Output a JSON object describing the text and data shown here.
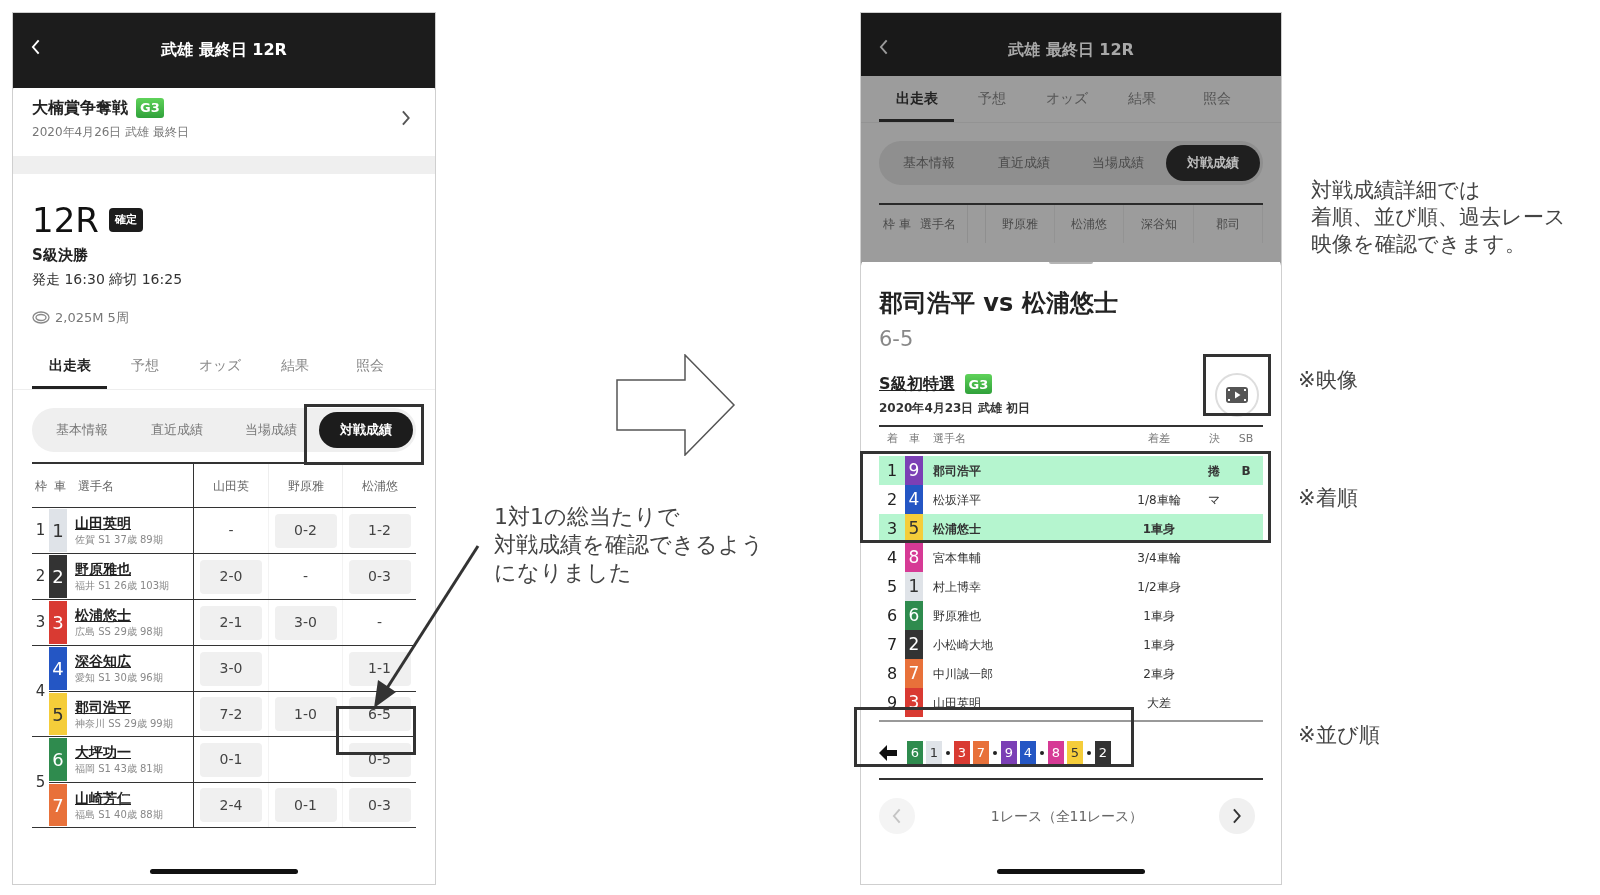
{
  "left_screen": {
    "header": {
      "title": "武雄 最終日 12R"
    },
    "event": {
      "name": "大楠賞争奪戦",
      "grade": "G3",
      "date": "2020年4月26日 武雄 最終日"
    },
    "race": {
      "number": "12R",
      "status": "確定",
      "class": "S級決勝",
      "times": "発走 16:30 締切 16:25",
      "distance": "2,025M 5周"
    },
    "tabs": [
      {
        "label": "出走表",
        "selected": true
      },
      {
        "label": "予想",
        "selected": false
      },
      {
        "label": "オッズ",
        "selected": false
      },
      {
        "label": "結果",
        "selected": false
      },
      {
        "label": "照会",
        "selected": false
      }
    ],
    "subtabs": [
      {
        "label": "基本情報",
        "selected": false
      },
      {
        "label": "直近成績",
        "selected": false
      },
      {
        "label": "当場成績",
        "selected": false
      },
      {
        "label": "対戦成績",
        "selected": true
      }
    ],
    "table": {
      "columns": [
        "枠",
        "車",
        "選手名",
        "山田英",
        "野原雅",
        "松浦悠"
      ],
      "frames": [
        {
          "label": "1",
          "riders": [
            {
              "car": "1",
              "color": "#dfe3e8",
              "name": "山田英明",
              "info": "佐賀 S1 37歳 89期",
              "results": [
                {
                  "kind": "self",
                  "value": "-"
                },
                {
                  "kind": "score",
                  "value": "0-2"
                },
                {
                  "kind": "score",
                  "value": "1-2"
                }
              ]
            }
          ]
        },
        {
          "label": "2",
          "riders": [
            {
              "car": "2",
              "color": "#333333",
              "name": "野原雅也",
              "info": "福井 S1 26歳 103期",
              "results": [
                {
                  "kind": "score",
                  "value": "2-0"
                },
                {
                  "kind": "self",
                  "value": "-"
                },
                {
                  "kind": "score",
                  "value": "0-3"
                }
              ]
            }
          ]
        },
        {
          "label": "3",
          "riders": [
            {
              "car": "3",
              "color": "#d93a32",
              "name": "松浦悠士",
              "info": "広島 SS 29歳 98期",
              "results": [
                {
                  "kind": "score",
                  "value": "2-1"
                },
                {
                  "kind": "score",
                  "value": "3-0"
                },
                {
                  "kind": "self",
                  "value": "-"
                }
              ]
            }
          ]
        },
        {
          "label": "4",
          "riders": [
            {
              "car": "4",
              "color": "#2456c4",
              "name": "深谷知広",
              "info": "愛知 S1 30歳 96期",
              "results": [
                {
                  "kind": "score",
                  "value": "3-0"
                },
                {
                  "kind": "blank"
                },
                {
                  "kind": "score",
                  "value": "1-1"
                }
              ]
            },
            {
              "car": "5",
              "color": "#f5cd3a",
              "name": "郡司浩平",
              "info": "神奈川 SS 29歳 99期",
              "results": [
                {
                  "kind": "score",
                  "value": "7-2"
                },
                {
                  "kind": "score",
                  "value": "1-0"
                },
                {
                  "kind": "score",
                  "value": "6-5"
                }
              ]
            }
          ]
        },
        {
          "label": "5",
          "riders": [
            {
              "car": "6",
              "color": "#2f8b4e",
              "name": "大坪功一",
              "info": "福岡 S1 43歳 81期",
              "results": [
                {
                  "kind": "score",
                  "value": "0-1"
                },
                {
                  "kind": "blank"
                },
                {
                  "kind": "score",
                  "value": "0-5"
                }
              ]
            },
            {
              "car": "7",
              "color": "#e8713a",
              "name": "山崎芳仁",
              "info": "福島 S1 40歳 88期",
              "results": [
                {
                  "kind": "score",
                  "value": "2-4"
                },
                {
                  "kind": "score",
                  "value": "0-1"
                },
                {
                  "kind": "score",
                  "value": "0-3"
                }
              ]
            }
          ]
        }
      ]
    }
  },
  "right_screen": {
    "header": {
      "title": "武雄 最終日 12R"
    },
    "tabs": [
      {
        "label": "出走表",
        "selected": true
      },
      {
        "label": "予想",
        "selected": false
      },
      {
        "label": "オッズ",
        "selected": false
      },
      {
        "label": "結果",
        "selected": false
      },
      {
        "label": "照会",
        "selected": false
      }
    ],
    "subtabs": [
      {
        "label": "基本情報",
        "selected": false
      },
      {
        "label": "直近成績",
        "selected": false
      },
      {
        "label": "当場成績",
        "selected": false
      },
      {
        "label": "対戦成績",
        "selected": true
      }
    ],
    "table_columns": [
      "枠 車",
      "選手名",
      "野原雅",
      "松浦悠",
      "深谷知",
      "郡司"
    ],
    "sheet": {
      "title": "郡司浩平 vs 松浦悠士",
      "score": "6-5",
      "race_name": "S級初特選",
      "grade": "G3",
      "date": "2020年4月23日 武雄 初日",
      "columns": [
        "着",
        "車",
        "選手名",
        "着差",
        "決",
        "SB"
      ],
      "rows": [
        {
          "place": "1",
          "car": "9",
          "color": "#7b3fb5",
          "name": "郡司浩平",
          "kimarite": "捲",
          "sb": "B",
          "highlighted": true
        },
        {
          "place": "2",
          "car": "4",
          "color": "#2456c4",
          "name": "松坂洋平",
          "margin": "1/8車輪",
          "kimarite": "マ",
          "highlighted": false
        },
        {
          "place": "3",
          "car": "5",
          "color": "#f5cd3a",
          "name": "松浦悠士",
          "margin": "1車身",
          "highlighted": true
        },
        {
          "place": "4",
          "car": "8",
          "color": "#d63a95",
          "name": "宮本隼輔",
          "margin": "3/4車輪",
          "highlighted": false
        },
        {
          "place": "5",
          "car": "1",
          "color": "#dfe3e8",
          "name": "村上博幸",
          "margin": "1/2車身",
          "highlighted": false
        },
        {
          "place": "6",
          "car": "6",
          "color": "#2f8b4e",
          "name": "野原雅也",
          "margin": "1車身",
          "highlighted": false
        },
        {
          "place": "7",
          "car": "2",
          "color": "#333333",
          "name": "小松崎大地",
          "margin": "1車身",
          "highlighted": false
        },
        {
          "place": "8",
          "car": "7",
          "color": "#e8713a",
          "name": "中川誠一郎",
          "margin": "2車身",
          "highlighted": false
        },
        {
          "place": "9",
          "car": "3",
          "color": "#d93a32",
          "name": "山田英明",
          "margin": "大差",
          "highlighted": false
        }
      ],
      "lineup": [
        {
          "kind": "car",
          "label": "6",
          "color": "#2f8b4e"
        },
        {
          "kind": "car",
          "label": "1",
          "color": "#dfe3e8"
        },
        {
          "kind": "dot"
        },
        {
          "kind": "car",
          "label": "3",
          "color": "#d93a32"
        },
        {
          "kind": "car",
          "label": "7",
          "color": "#e8713a"
        },
        {
          "kind": "dot"
        },
        {
          "kind": "car",
          "label": "9",
          "color": "#7b3fb5"
        },
        {
          "kind": "car",
          "label": "4",
          "color": "#2456c4"
        },
        {
          "kind": "dot"
        },
        {
          "kind": "car",
          "label": "8",
          "color": "#d63a95"
        },
        {
          "kind": "car",
          "label": "5",
          "color": "#f5cd3a"
        },
        {
          "kind": "dot"
        },
        {
          "kind": "car",
          "label": "2",
          "color": "#333333"
        }
      ],
      "pager": {
        "label": "1レース（全11レース）",
        "prev_disabled": true,
        "next_disabled": false
      }
    }
  },
  "notes": {
    "middle": [
      "1対1の総当たりで",
      "対戦成績を確認できるよう",
      "になりました"
    ],
    "right": [
      "対戦成績詳細では",
      "着順、並び順、過去レース",
      "映像を確認できます。"
    ],
    "video": "※映像",
    "order": "※着順",
    "lineup": "※並び順"
  }
}
